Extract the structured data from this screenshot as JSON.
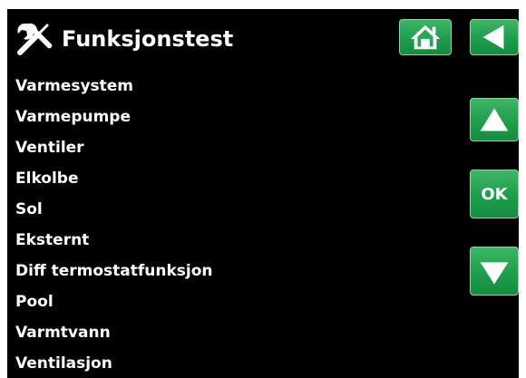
{
  "header": {
    "title": "Funksjonstest",
    "icon": "tools-icon"
  },
  "menu": {
    "items": [
      {
        "label": "Varmesystem"
      },
      {
        "label": "Varmepumpe"
      },
      {
        "label": "Ventiler"
      },
      {
        "label": "Elkolbe"
      },
      {
        "label": "Sol"
      },
      {
        "label": "Eksternt"
      },
      {
        "label": "Diff termostatfunksjon"
      },
      {
        "label": "Pool"
      },
      {
        "label": "Varmtvann"
      },
      {
        "label": "Ventilasjon"
      }
    ]
  },
  "buttons": {
    "home_icon": "home-icon",
    "back_icon": "back-arrow-icon",
    "up_icon": "up-arrow-icon",
    "ok_label": "OK",
    "down_icon": "down-arrow-icon"
  },
  "colors": {
    "background": "#000000",
    "text": "#ffffff",
    "button_green": "#1d9e4c",
    "button_border": "#8fd39e"
  }
}
